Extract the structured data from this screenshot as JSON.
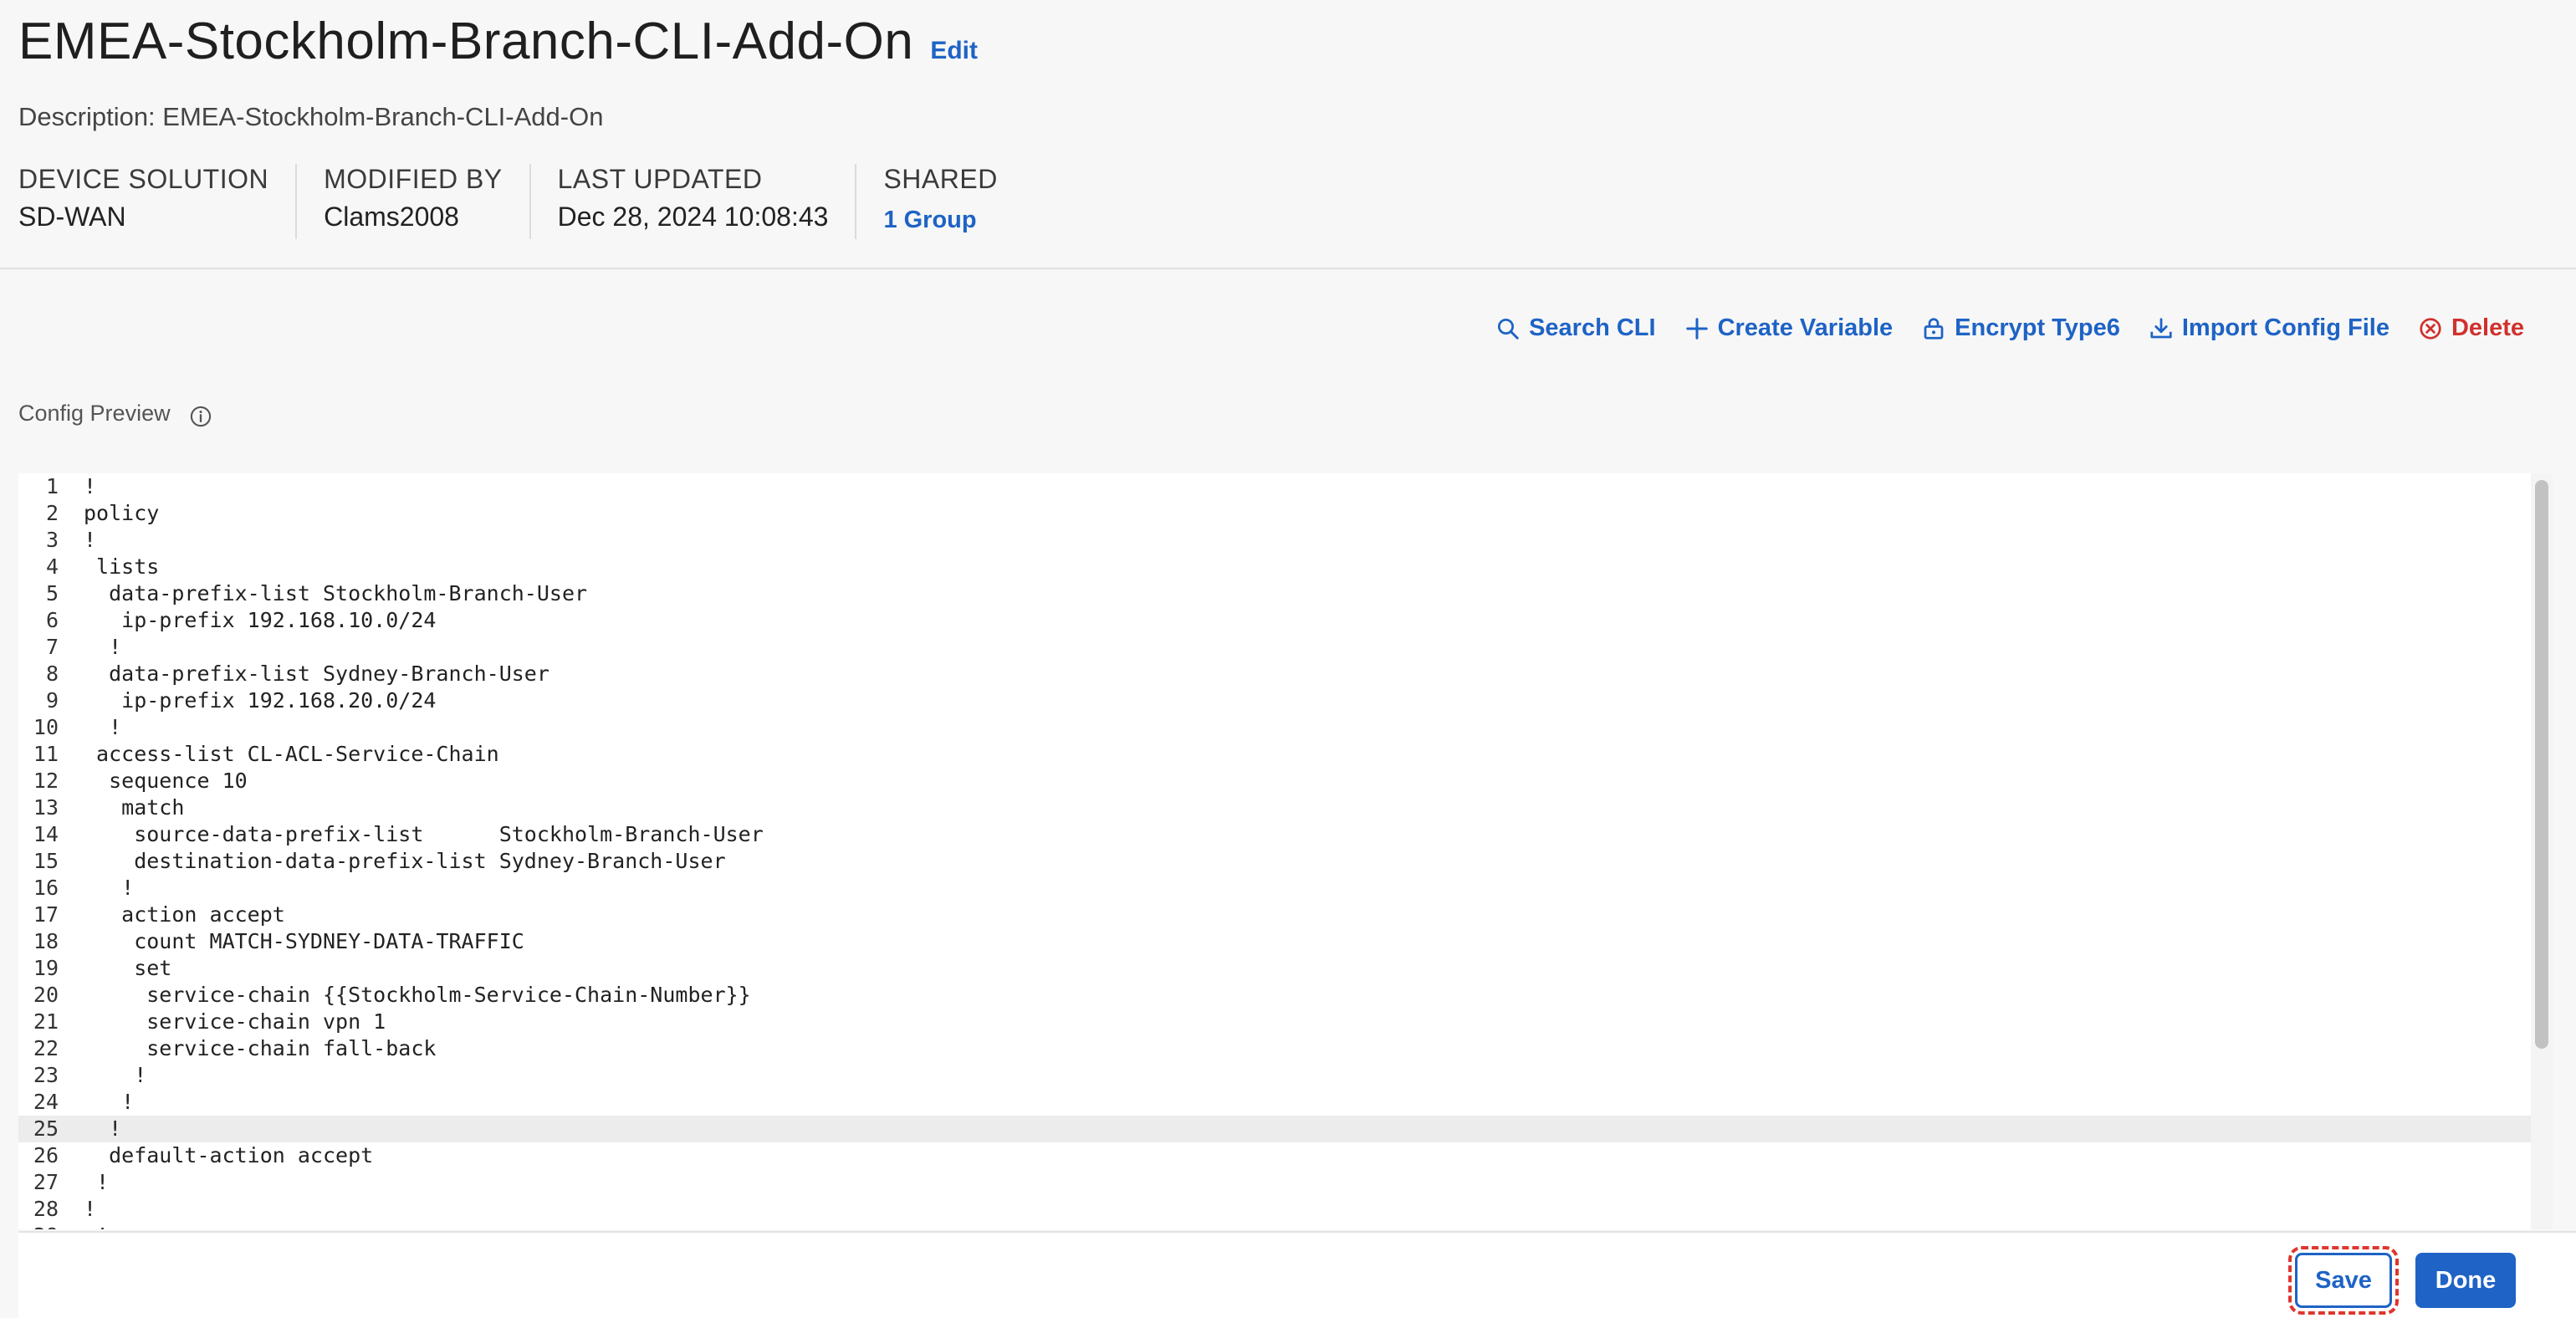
{
  "page": {
    "title": "EMEA-Stockholm-Branch-CLI-Add-On",
    "edit_label": "Edit",
    "description": "Description: EMEA-Stockholm-Branch-CLI-Add-On"
  },
  "meta": {
    "device_solution": {
      "label": "DEVICE SOLUTION",
      "value": "SD-WAN"
    },
    "modified_by": {
      "label": "MODIFIED BY",
      "value": "Clams2008"
    },
    "last_updated": {
      "label": "LAST UPDATED",
      "value": "Dec 28, 2024 10:08:43"
    },
    "shared": {
      "label": "SHARED",
      "value": "1 Group"
    }
  },
  "toolbar": {
    "search_cli": "Search CLI",
    "create_variable": "Create Variable",
    "encrypt_type6": "Encrypt Type6",
    "import_config": "Import Config File",
    "delete": "Delete"
  },
  "preview": {
    "label": "Config Preview",
    "active_line": 25,
    "lines": [
      "!",
      "policy",
      "!",
      " lists",
      "  data-prefix-list Stockholm-Branch-User",
      "   ip-prefix 192.168.10.0/24",
      "  !",
      "  data-prefix-list Sydney-Branch-User",
      "   ip-prefix 192.168.20.0/24",
      "  !",
      " access-list CL-ACL-Service-Chain",
      "  sequence 10",
      "   match",
      "    source-data-prefix-list      Stockholm-Branch-User",
      "    destination-data-prefix-list Sydney-Branch-User",
      "   !",
      "   action accept",
      "    count MATCH-SYDNEY-DATA-TRAFFIC",
      "    set",
      "     service-chain {{Stockholm-Service-Chain-Number}}",
      "     service-chain vpn 1",
      "     service-chain fall-back",
      "    !",
      "   !",
      "  !",
      "  default-action accept",
      " !",
      "!",
      " !"
    ]
  },
  "footer": {
    "save_label": "Save",
    "done_label": "Done"
  },
  "colors": {
    "link": "#1e63c5",
    "danger": "#d0312d",
    "highlight_outline": "#e0362c"
  }
}
